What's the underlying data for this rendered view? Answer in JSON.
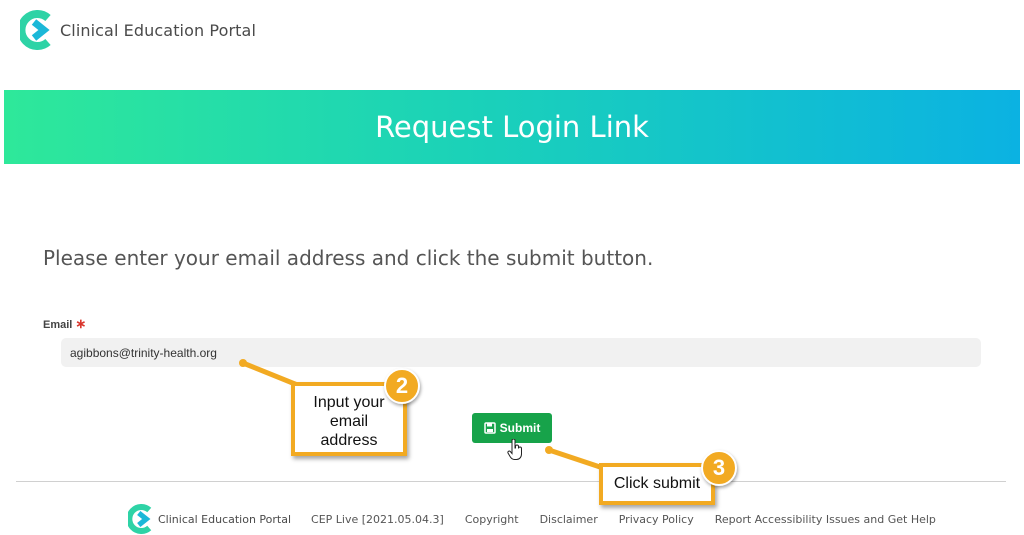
{
  "header": {
    "logo_text": "Clinical Education Portal"
  },
  "banner": {
    "title": "Request Login Link"
  },
  "form": {
    "instructions": "Please enter your email address and click the submit button.",
    "email_label": "Email",
    "required_marker": "∗",
    "email_value": "agibbons@trinity-health.org",
    "submit_label": "Submit",
    "submit_icon": "save-icon"
  },
  "footer": {
    "logo_text": "Clinical Education Portal",
    "version": "CEP Live [2021.05.04.3]",
    "links": [
      "Copyright",
      "Disclaimer",
      "Privacy Policy",
      "Report Accessibility Issues and Get Help"
    ]
  },
  "annotations": {
    "step2": {
      "number": "2",
      "line1": "Input your",
      "line2": "email",
      "line3": "address"
    },
    "step3": {
      "number": "3",
      "text": "Click submit"
    },
    "color": "#f2aa22"
  },
  "colors": {
    "banner_start": "#2ee89a",
    "banner_end": "#0bb2e2",
    "submit": "#17a34a",
    "required": "#d9342b"
  }
}
